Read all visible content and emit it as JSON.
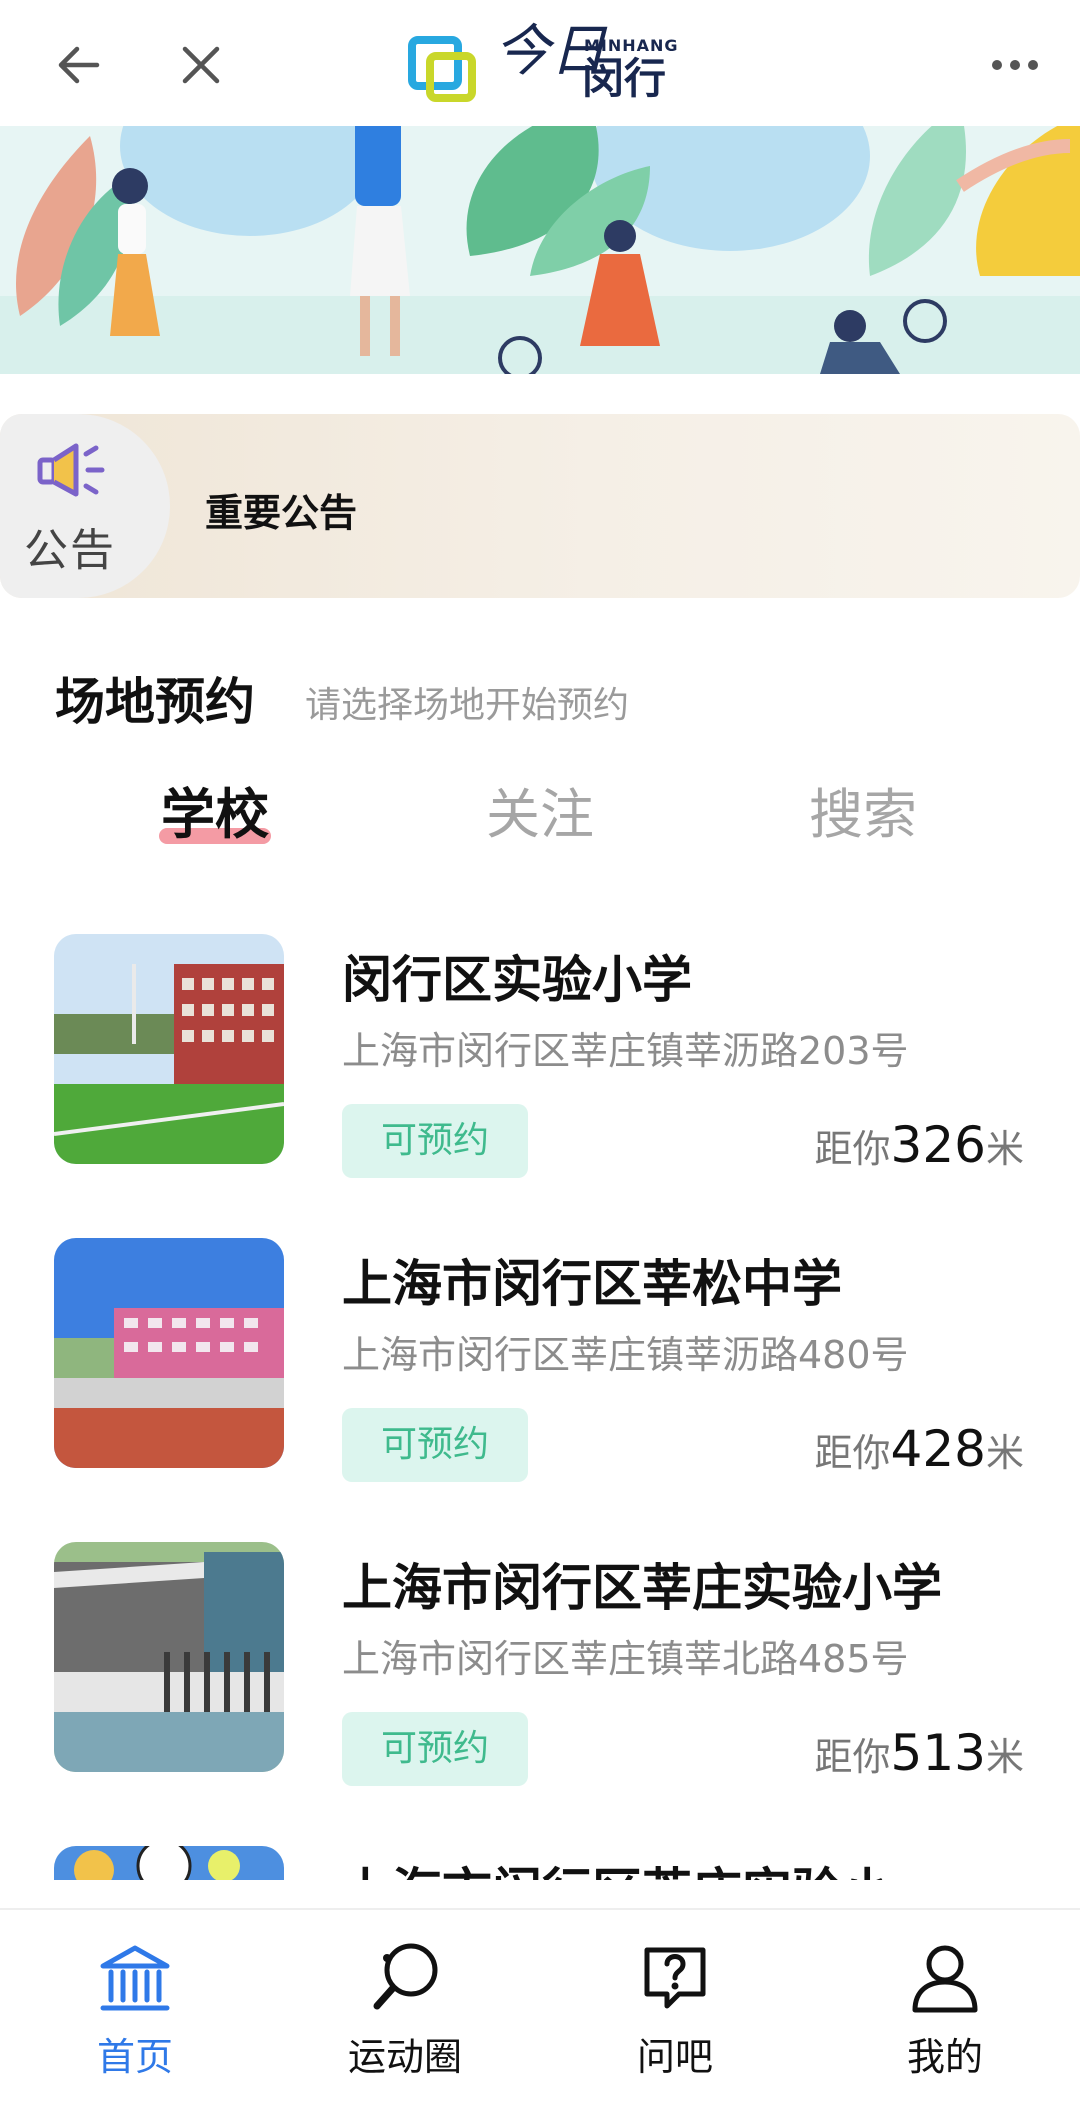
{
  "header": {
    "logo_script": "今日",
    "logo_en": "MINHANG",
    "logo_cn": "闵行",
    "icons": [
      "back-arrow-icon",
      "close-icon",
      "more-icon"
    ]
  },
  "notice": {
    "tag_label": "公告",
    "title": "重要公告",
    "icon": "megaphone-icon"
  },
  "section": {
    "title": "场地预约",
    "subtitle": "请选择场地开始预约"
  },
  "tabs": [
    {
      "label": "学校",
      "active": true
    },
    {
      "label": "关注",
      "active": false
    },
    {
      "label": "搜索",
      "active": false
    }
  ],
  "venues": [
    {
      "name": "闵行区实验小学",
      "address": "上海市闵行区莘庄镇莘沥路203号",
      "status": "可预约",
      "distance_prefix": "距你",
      "distance": "326",
      "distance_unit": "米"
    },
    {
      "name": "上海市闵行区莘松中学",
      "address": "上海市闵行区莘庄镇莘沥路480号",
      "status": "可预约",
      "distance_prefix": "距你",
      "distance": "428",
      "distance_unit": "米"
    },
    {
      "name": "上海市闵行区莘庄实验小学",
      "address": "上海市闵行区莘庄镇莘北路485号",
      "status": "可预约",
      "distance_prefix": "距你",
      "distance": "513",
      "distance_unit": "米"
    },
    {
      "name": "上海市闵行区莘庄实验小",
      "address": "",
      "status": "",
      "distance_prefix": "",
      "distance": "",
      "distance_unit": ""
    }
  ],
  "tabbar": [
    {
      "label": "首页",
      "icon": "home-icon",
      "active": true
    },
    {
      "label": "运动圈",
      "icon": "ping-pong-paddle-icon",
      "active": false
    },
    {
      "label": "问吧",
      "icon": "question-bubble-icon",
      "active": false
    },
    {
      "label": "我的",
      "icon": "user-icon",
      "active": false
    }
  ],
  "colors": {
    "accent_blue": "#2f79e8",
    "badge_green": "#3fba8d",
    "badge_bg": "#dcf5ee",
    "tab_underline": "#f28a94"
  }
}
